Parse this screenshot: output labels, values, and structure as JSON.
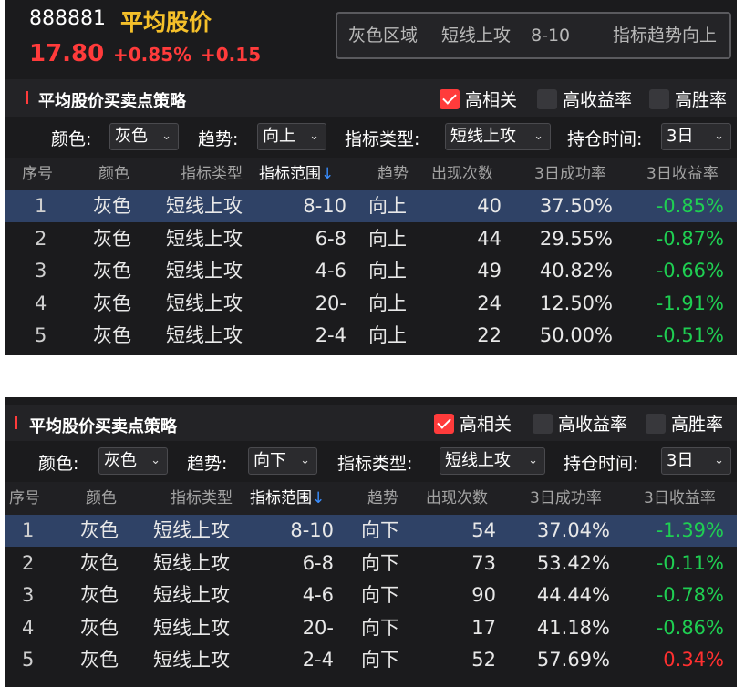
{
  "stock": {
    "code": "888881",
    "name": "平均股价",
    "price": "17.80",
    "change_pct": "+0.85%",
    "change": "+0.15"
  },
  "info_box": {
    "zone": "灰色区域",
    "type": "短线上攻",
    "range": "8-10",
    "trend": "指标趋势向上"
  },
  "panels": [
    {
      "title": "平均股价买卖点策略",
      "checkboxes": [
        {
          "label": "高相关",
          "checked": true
        },
        {
          "label": "高收益率",
          "checked": false
        },
        {
          "label": "高胜率",
          "checked": false
        }
      ],
      "filters": {
        "color_label": "颜色:",
        "color_value": "灰色",
        "trend_label": "趋势:",
        "trend_value": "向上",
        "type_label": "指标类型:",
        "type_value": "短线上攻",
        "hold_label": "持仓时间:",
        "hold_value": "3日"
      },
      "columns": [
        "序号",
        "颜色",
        "指标类型",
        "指标范围↓",
        "趋势",
        "出现次数",
        "3日成功率",
        "3日收益率"
      ],
      "rows": [
        {
          "idx": "1",
          "color": "灰色",
          "type": "短线上攻",
          "range": "8-10",
          "trend": "向上",
          "count": "40",
          "success": "37.50%",
          "ret": "-0.85%",
          "ret_sign": "neg"
        },
        {
          "idx": "2",
          "color": "灰色",
          "type": "短线上攻",
          "range": "6-8",
          "trend": "向上",
          "count": "44",
          "success": "29.55%",
          "ret": "-0.87%",
          "ret_sign": "neg"
        },
        {
          "idx": "3",
          "color": "灰色",
          "type": "短线上攻",
          "range": "4-6",
          "trend": "向上",
          "count": "49",
          "success": "40.82%",
          "ret": "-0.66%",
          "ret_sign": "neg"
        },
        {
          "idx": "4",
          "color": "灰色",
          "type": "短线上攻",
          "range": "20-",
          "trend": "向上",
          "count": "24",
          "success": "12.50%",
          "ret": "-1.91%",
          "ret_sign": "neg"
        },
        {
          "idx": "5",
          "color": "灰色",
          "type": "短线上攻",
          "range": "2-4",
          "trend": "向上",
          "count": "22",
          "success": "50.00%",
          "ret": "-0.51%",
          "ret_sign": "neg"
        }
      ]
    },
    {
      "title": "平均股价买卖点策略",
      "checkboxes": [
        {
          "label": "高相关",
          "checked": true
        },
        {
          "label": "高收益率",
          "checked": false
        },
        {
          "label": "高胜率",
          "checked": false
        }
      ],
      "filters": {
        "color_label": "颜色:",
        "color_value": "灰色",
        "trend_label": "趋势:",
        "trend_value": "向下",
        "type_label": "指标类型:",
        "type_value": "短线上攻",
        "hold_label": "持仓时间:",
        "hold_value": "3日"
      },
      "columns": [
        "序号",
        "颜色",
        "指标类型",
        "指标范围↓",
        "趋势",
        "出现次数",
        "3日成功率",
        "3日收益率"
      ],
      "rows": [
        {
          "idx": "1",
          "color": "灰色",
          "type": "短线上攻",
          "range": "8-10",
          "trend": "向下",
          "count": "54",
          "success": "37.04%",
          "ret": "-1.39%",
          "ret_sign": "neg"
        },
        {
          "idx": "2",
          "color": "灰色",
          "type": "短线上攻",
          "range": "6-8",
          "trend": "向下",
          "count": "73",
          "success": "53.42%",
          "ret": "-0.11%",
          "ret_sign": "neg"
        },
        {
          "idx": "3",
          "color": "灰色",
          "type": "短线上攻",
          "range": "4-6",
          "trend": "向下",
          "count": "90",
          "success": "44.44%",
          "ret": "-0.78%",
          "ret_sign": "neg"
        },
        {
          "idx": "4",
          "color": "灰色",
          "type": "短线上攻",
          "range": "20-",
          "trend": "向下",
          "count": "17",
          "success": "41.18%",
          "ret": "-0.86%",
          "ret_sign": "neg"
        },
        {
          "idx": "5",
          "color": "灰色",
          "type": "短线上攻",
          "range": "2-4",
          "trend": "向下",
          "count": "52",
          "success": "57.69%",
          "ret": "0.34%",
          "ret_sign": "pos"
        }
      ]
    }
  ],
  "theme": {
    "background": "#1b1b1d",
    "accent_red": "#ff3b3b",
    "gain_green": "#1fcf52",
    "selected_row": "#2f4266",
    "title_gold": "#f5c02a",
    "sort_arrow": "#3a8eff"
  },
  "icons": {
    "dropdown": "chevron-down-icon",
    "checked": "checkmark-icon",
    "marker": "red-bar-icon",
    "sort": "down-arrow-icon"
  }
}
